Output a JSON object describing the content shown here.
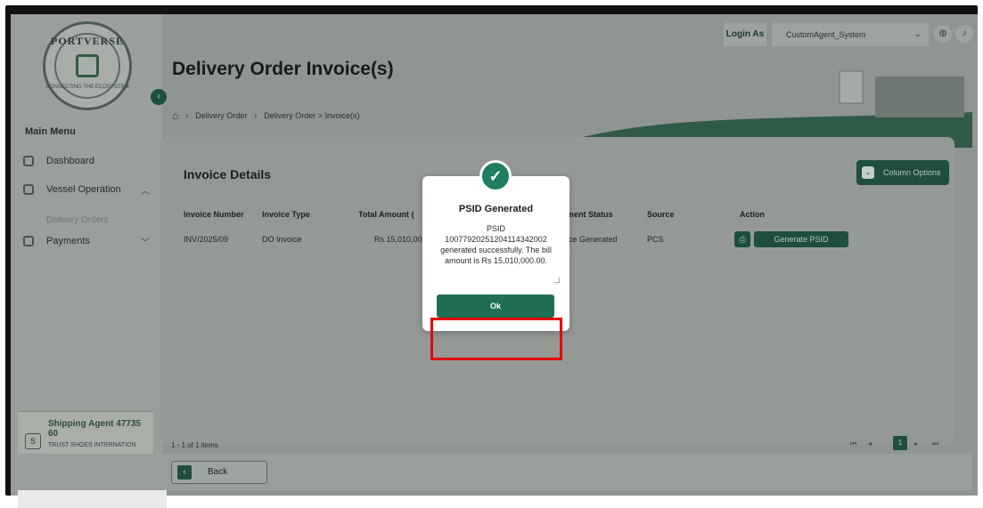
{
  "sidebar": {
    "logo_text": "PORTVERSE",
    "logo_tagline": "CONNECTING THE ECOSYSTEM",
    "collapse_icon": "chevron-left-icon",
    "menu_title": "Main Menu",
    "items": [
      {
        "label": "Dashboard",
        "icon": "dashboard-icon"
      },
      {
        "label": "Vessel Operation",
        "icon": "ship-icon",
        "expanded": true
      },
      {
        "label": "Payments",
        "icon": "payment-icon",
        "expanded": false
      }
    ],
    "sub_item": "Delivery Orders",
    "agent": {
      "initial": "S",
      "name": "Shipping Agent 47735 60",
      "company": "TRUST SHOES INTERNATION"
    }
  },
  "topbar": {
    "login_as_label": "Login As",
    "role_value": "CustomAgent_System"
  },
  "page": {
    "title": "Delivery Order Invoice(s)",
    "breadcrumb": [
      "Delivery Order",
      "Delivery Order > Invoice(s)"
    ]
  },
  "card": {
    "title": "Invoice Details",
    "column_options_label": "Column Options",
    "columns": [
      "Invoice Number",
      "Invoice Type",
      "Total Amount (",
      "ment Status",
      "Source",
      "Action"
    ],
    "rows": [
      {
        "invoice_number": "INV/2025/09",
        "invoice_type": "DO Invoice",
        "total_amount": "Rs 15,010,000",
        "status": "ice Generated",
        "source": "PCS",
        "action_label": "Generate PSID"
      }
    ],
    "pager_info": "1 - 1 of 1 items",
    "current_page": "1"
  },
  "footer": {
    "back_label": "Back"
  },
  "modal": {
    "title": "PSID Generated",
    "message_line1": "PSID",
    "message_line2": "10077920251204114342002",
    "message_line3": "generated successfully. The bill",
    "message_line4": "amount is Rs 15,010,000.00.",
    "ok_label": "Ok"
  },
  "colors": {
    "brand_green": "#1f6f55",
    "highlight_red": "#e60000"
  }
}
